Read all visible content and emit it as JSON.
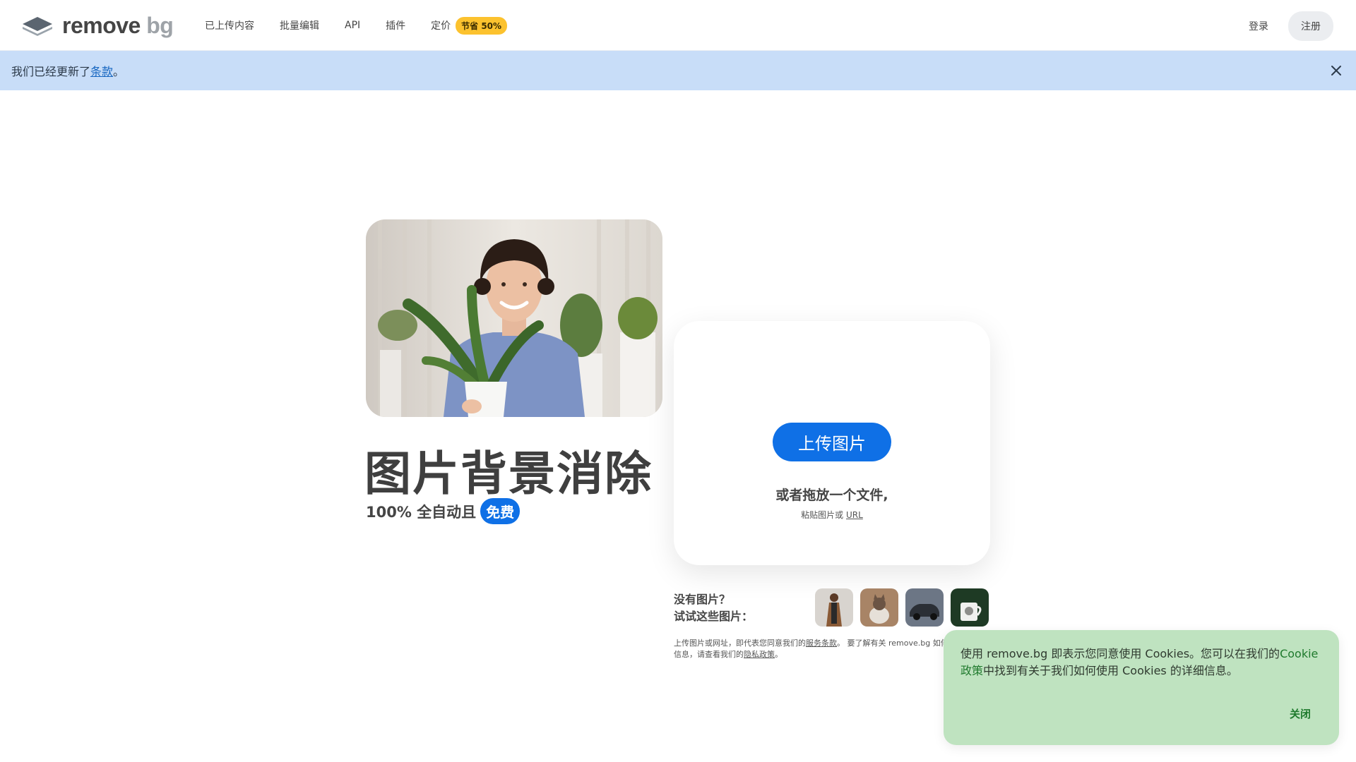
{
  "brand": {
    "name_main": "remove",
    "name_suffix": "bg"
  },
  "nav": {
    "items": [
      {
        "label": "已上传内容"
      },
      {
        "label": "批量编辑"
      },
      {
        "label": "API"
      },
      {
        "label": "插件"
      },
      {
        "label": "定价"
      }
    ],
    "pricing_badge": "节省 50%"
  },
  "header_right": {
    "login": "登录",
    "signup": "注册"
  },
  "notice": {
    "prefix": "我们已经更新了",
    "link": "条款",
    "suffix": "。"
  },
  "hero": {
    "title": "图片背景消除",
    "subtitle": "100% 全自动且",
    "badge": "免费"
  },
  "upload": {
    "button": "上传图片",
    "drop_text": "或者拖放一个文件,",
    "paste_prefix": "粘贴图片或",
    "paste_url": "URL"
  },
  "samples": {
    "line1": "没有图片？",
    "line2": "试试这些图片："
  },
  "legal": {
    "part1": "上传图片或网址，即代表您同意我们的",
    "terms": "服务条款",
    "part2": "。 要了解有关 remove.bg 如何处理您的个人数据的更多信息，请查看我们的",
    "privacy": "隐私政策",
    "part3": "。"
  },
  "cookie": {
    "text1": "使用 remove.bg 即表示您同意使用 Cookies。您可以在我们的",
    "link": "Cookie政策",
    "text2": "中找到有关于我们如何使用 Cookies 的详细信息。",
    "close": "关闭"
  },
  "colors": {
    "primary": "#0f70e6",
    "notice_bg": "#c8ddf8",
    "badge_yellow": "#fcc22e",
    "cookie_bg": "#bfe3c0",
    "cookie_link": "#1f7a2d"
  }
}
